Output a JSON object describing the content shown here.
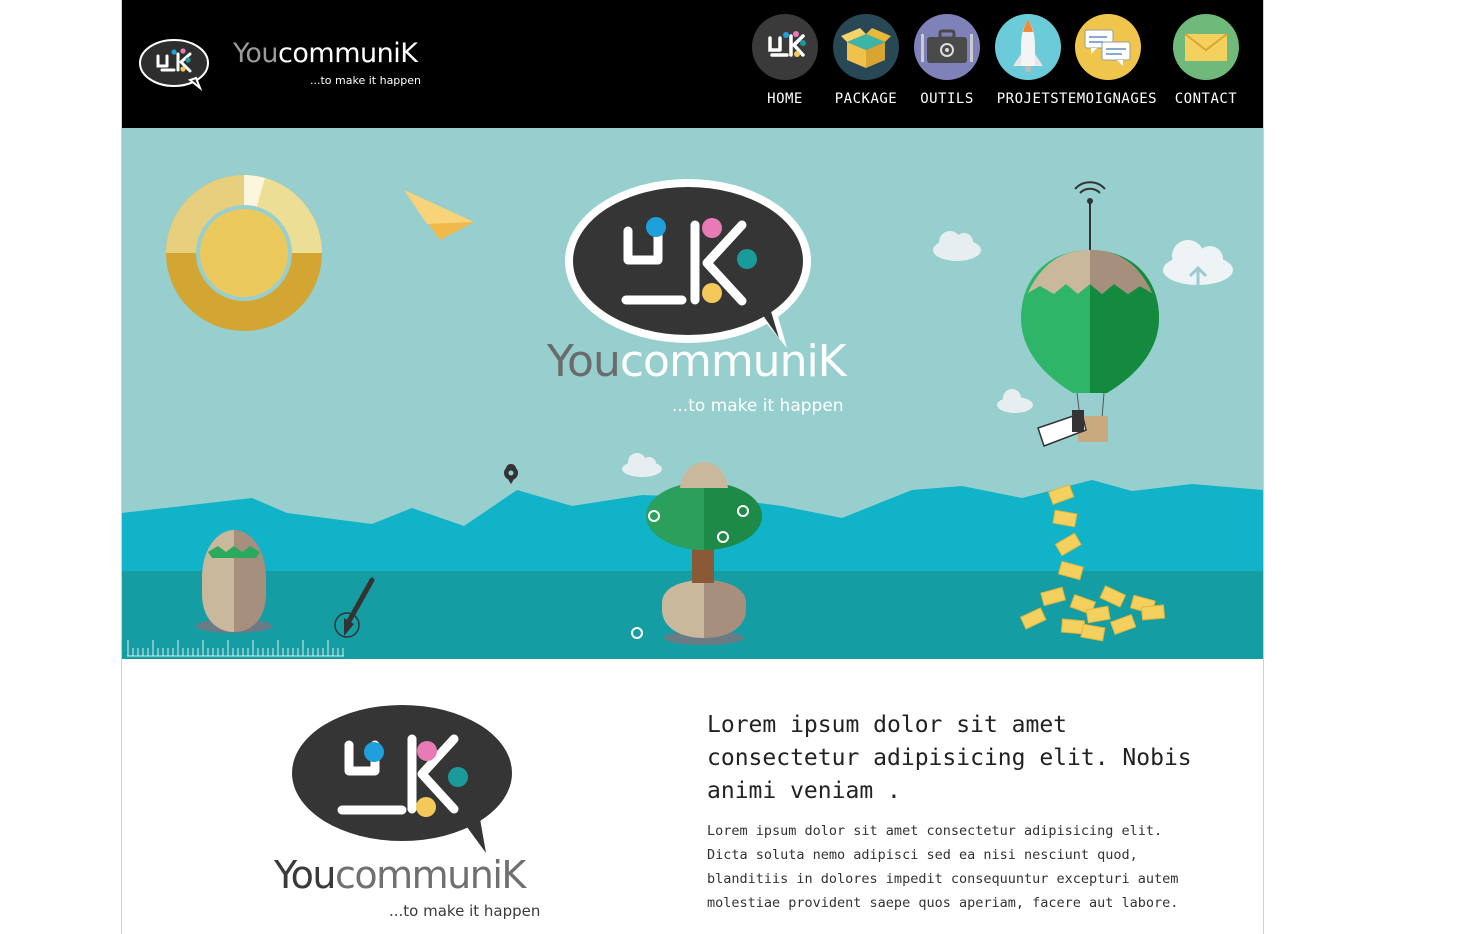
{
  "header": {
    "brand_first": "You",
    "brand_rest": "communiK",
    "tagline": "...to make it happen",
    "nav": [
      {
        "label": "HOME",
        "icon": "ycK-logo-icon",
        "color": "#3a3a3a"
      },
      {
        "label": "PACKAGE",
        "icon": "package-box-icon",
        "color": "#274854"
      },
      {
        "label": "OUTILS",
        "icon": "toolbox-icon",
        "color": "#7f82b8"
      },
      {
        "label": "PROJETS",
        "icon": "rocket-icon",
        "color": "#6bcbd8"
      },
      {
        "label": "TEMOIGNAGES",
        "icon": "speech-bubbles-icon",
        "color": "#efc64b"
      },
      {
        "label": "CONTACT",
        "icon": "envelope-icon",
        "color": "#6fba7a"
      }
    ]
  },
  "hero": {
    "brand_first": "You",
    "brand_rest": "communiK",
    "tagline": "...to make it happen",
    "background": "#96cfcd"
  },
  "content": {
    "brand_first": "You",
    "brand_rest": "communiK",
    "tagline": "...to make it happen",
    "title": "Lorem ipsum dolor sit amet consectetur adipisicing elit. Nobis animi veniam .",
    "body": "Lorem ipsum dolor sit amet consectetur adipisicing elit. Dicta soluta nemo adipisci sed ea nisi nesciunt quod, blanditiis in dolores impedit consequuntur excepturi autem molestiae provident saepe quos aperiam, facere aut labore."
  }
}
